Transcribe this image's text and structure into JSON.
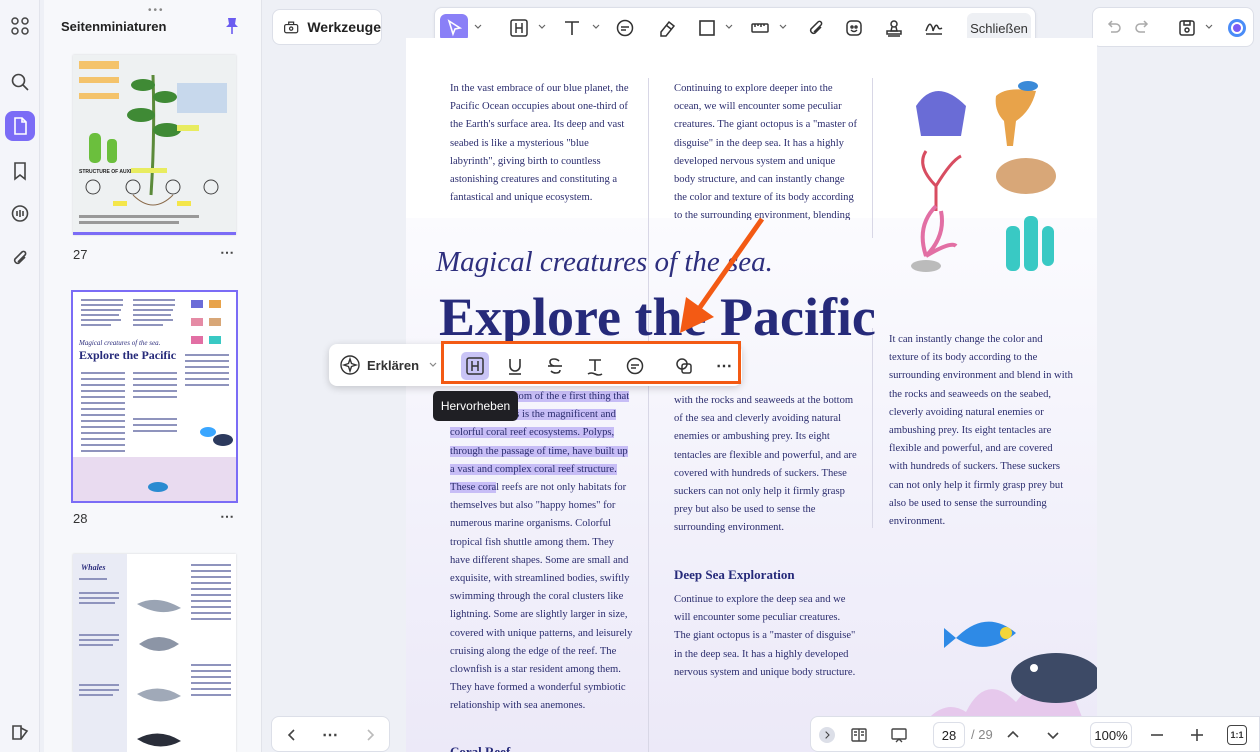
{
  "sidebar": {
    "panel_title": "Seitenminiaturen",
    "thumbnails": [
      {
        "page": "27",
        "title": "STRUCTURE OF AUXIN"
      },
      {
        "page": "28",
        "title": "Explore the Pacific",
        "subtitle": "Magical creatures of the sea."
      },
      {
        "page": "",
        "title": "Whales"
      }
    ]
  },
  "toolbar": {
    "tools_label": "Werkzeuge",
    "close_label": "Schließen"
  },
  "document": {
    "col1_top": "In the vast embrace of our blue planet, the Pacific Ocean occupies about one-third of the Earth's surface area. Its deep and vast seabed is like a mysterious \"blue labyrinth\", giving birth to countless astonishing creatures and constituting a fantastical and unique ecosystem.",
    "col2_top": "Continuing to explore deeper into the ocean, we will encounter some peculiar creatures. The giant octopus is a \"master of disguise\" in the deep sea. It has a highly developed nervous system and unique body structure, and can instantly change the color and texture of its body according to the surrounding environment, blending in",
    "subtitle": "Magical creatures of the sea.",
    "title": "Explore the Pacific",
    "col1_highlight": "eep into the bottom of the e first thing that catches our eyes is the magnificent and colorful coral reef ecosystems. Polyps, through the passage of time, have built up a vast and complex coral reef structure. These cora",
    "col1_rest": "l reefs are not only habitats for themselves but also \"happy homes\" for numerous marine organisms. Colorful tropical fish shuttle among them. They have different shapes. Some are small and exquisite, with streamlined bodies, swiftly swimming through the coral clusters like lightning. Some are slightly larger in size, covered with unique patterns, and leisurely cruising along the edge of the reef. The clownfish is a star resident among them. They have formed a wonderful symbiotic relationship with sea anemones.",
    "col2_mid": "with the rocks and seaweeds at the bottom of the sea and cleverly avoiding natural enemies or ambushing prey. Its eight tentacles are flexible and powerful, and are covered with hundreds of suckers. These suckers can not only help it firmly grasp prey but also be used to sense the surrounding environment.",
    "section_heading": "Deep Sea Exploration",
    "col2_bottom": "Continue to explore the deep sea and we will encounter some peculiar creatures. The giant octopus is a \"master of disguise\" in the deep sea. It has a highly developed nervous system and unique body structure.",
    "col3": "It can instantly change the color and texture of its body according to the surrounding environment and blend in with the rocks and seaweeds on the seabed, cleverly avoiding natural enemies or ambushing prey. Its eight tentacles are flexible and powerful, and are covered with hundreds of suckers. These suckers can not only help it firmly grasp prey but also be used to sense the surrounding environment.",
    "coral_heading": "Coral Reef"
  },
  "floating_toolbar": {
    "explain_label": "Erklären",
    "tooltip": "Hervorheben"
  },
  "navigation": {
    "current_page": "28",
    "total_pages": "/ 29",
    "zoom": "100%",
    "fit_label": "1:1"
  }
}
